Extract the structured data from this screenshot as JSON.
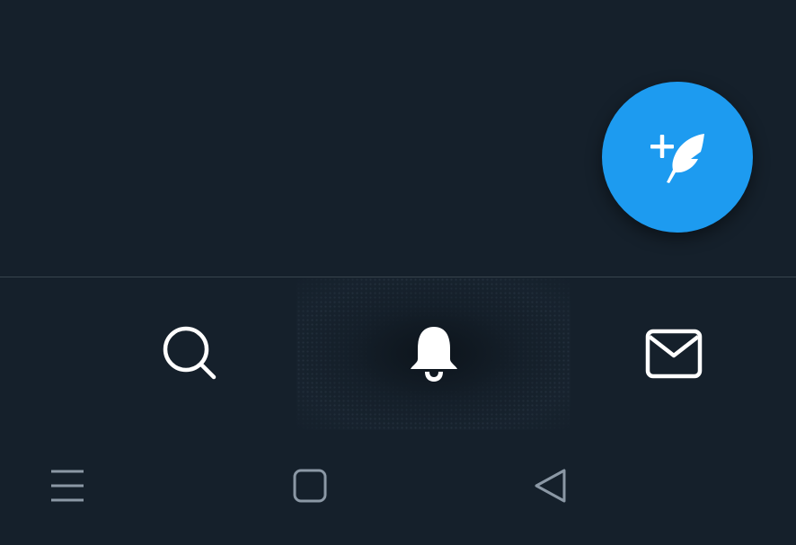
{
  "colors": {
    "background": "#15202b",
    "accent": "#1d9bf0",
    "divider": "#38444d",
    "icon_active": "#ffffff",
    "system_nav_icon": "#8b98a5"
  },
  "fab": {
    "icon": "compose-tweet-icon",
    "action": "compose"
  },
  "tabs": [
    {
      "id": "search",
      "icon": "search-icon"
    },
    {
      "id": "notifications",
      "icon": "bell-icon",
      "pressed": true
    },
    {
      "id": "messages",
      "icon": "mail-icon"
    }
  ],
  "system_nav": [
    {
      "id": "menu",
      "icon": "menu-icon"
    },
    {
      "id": "home",
      "icon": "home-square-icon"
    },
    {
      "id": "back",
      "icon": "back-triangle-icon"
    }
  ]
}
